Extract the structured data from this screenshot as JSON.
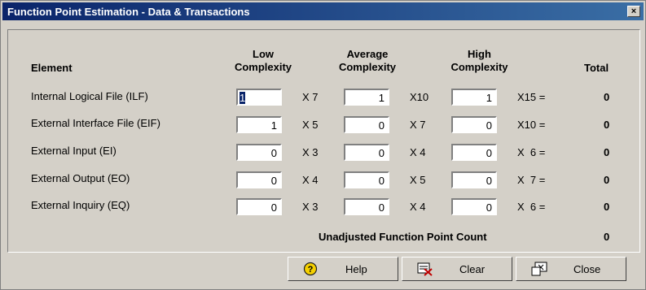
{
  "window": {
    "title": "Function Point Estimation - Data & Transactions",
    "close_glyph": "×"
  },
  "headers": {
    "element": "Element",
    "low": [
      "Low",
      "Complexity"
    ],
    "average": [
      "Average",
      "Complexity"
    ],
    "high": [
      "High",
      "Complexity"
    ],
    "total": "Total"
  },
  "rows": [
    {
      "label": "Internal Logical File (ILF)",
      "low": "1",
      "low_mult": "X 7",
      "avg": "1",
      "avg_mult": "X10",
      "high": "1",
      "high_mult": "X15 =",
      "total": "0"
    },
    {
      "label": "External Interface File (EIF)",
      "low": "1",
      "low_mult": "X 5",
      "avg": "0",
      "avg_mult": "X 7",
      "high": "0",
      "high_mult": "X10 =",
      "total": "0"
    },
    {
      "label": "External Input (EI)",
      "low": "0",
      "low_mult": "X 3",
      "avg": "0",
      "avg_mult": "X 4",
      "high": "0",
      "high_mult": "X  6 =",
      "total": "0"
    },
    {
      "label": "External Output (EO)",
      "low": "0",
      "low_mult": "X 4",
      "avg": "0",
      "avg_mult": "X 5",
      "high": "0",
      "high_mult": "X  7 =",
      "total": "0"
    },
    {
      "label": "External Inquiry (EQ)",
      "low": "0",
      "low_mult": "X 3",
      "avg": "0",
      "avg_mult": "X 4",
      "high": "0",
      "high_mult": "X  6 =",
      "total": "0"
    }
  ],
  "ufpc": {
    "label": "Unadjusted Function Point Count",
    "value": "0"
  },
  "buttons": {
    "help": "Help",
    "clear": "Clear",
    "close": "Close"
  },
  "icons": {
    "help": "help-icon",
    "clear": "clear-icon",
    "close": "close-window-icon"
  }
}
